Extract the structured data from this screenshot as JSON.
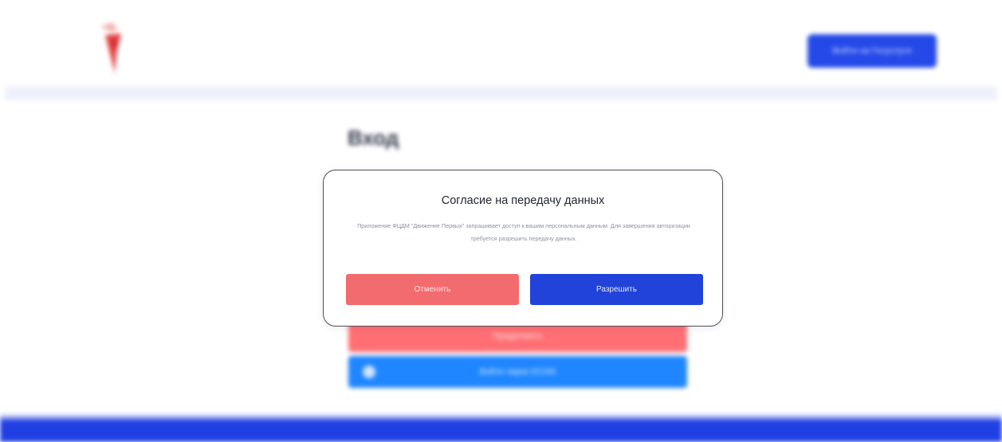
{
  "header": {
    "login_button_label": "Войти на Госуслуги"
  },
  "main": {
    "title": "Вход",
    "primary_button_label": "Продолжить",
    "gosuslugi_button_label": "Войти через ЕСИА"
  },
  "consent_modal": {
    "title": "Согласие на передачу данных",
    "text": "Приложение ФЦДМ \"Движение Первых\" запрашивает доступ к вашим персональным данным. Для завершения авторизации требуется разрешить передачу данных.",
    "decline_label": "Отменить",
    "allow_label": "Разрешить"
  },
  "colors": {
    "accent_blue": "#2143d9",
    "accent_red": "#f26b6e",
    "footer_blue": "#1f3fe3"
  }
}
